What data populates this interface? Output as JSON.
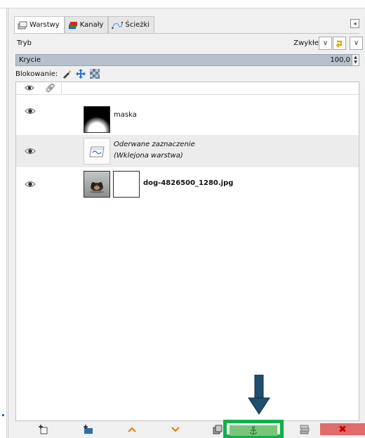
{
  "tabs": [
    {
      "label": "Warstwy",
      "icon": "layers-icon",
      "active": true
    },
    {
      "label": "Kanały",
      "icon": "channels-icon",
      "active": false
    },
    {
      "label": "Ścieżki",
      "icon": "paths-icon",
      "active": false
    }
  ],
  "mode": {
    "label": "Tryb",
    "value": "Zwykłe"
  },
  "opacity": {
    "label": "Krycie",
    "value": "100,0"
  },
  "lock": {
    "label": "Blokowanie:"
  },
  "layers": [
    {
      "name": "maska",
      "visible": true,
      "italic": false,
      "bold": false
    },
    {
      "name_line1": "Oderwane zaznaczenie",
      "name_line2": "(Wklejona warstwa)",
      "visible": true,
      "italic": true
    },
    {
      "name": "dog-4826500_1280.jpg",
      "visible": true,
      "bold": true
    }
  ],
  "toolbar": {
    "buttons": [
      "new-layer-icon",
      "new-group-icon",
      "raise-layer-icon",
      "lower-layer-icon",
      "duplicate-layer-icon",
      "anchor-layer-icon",
      "merge-down-icon",
      "delete-layer-icon"
    ],
    "delete_symbol": "✖"
  },
  "colors": {
    "highlight_border": "#0db14b",
    "anchor_button": "#79c579",
    "delete_button": "#e26a6a",
    "arrow": "#1f4f6e",
    "opacity_bar": "#b7c1cc"
  }
}
